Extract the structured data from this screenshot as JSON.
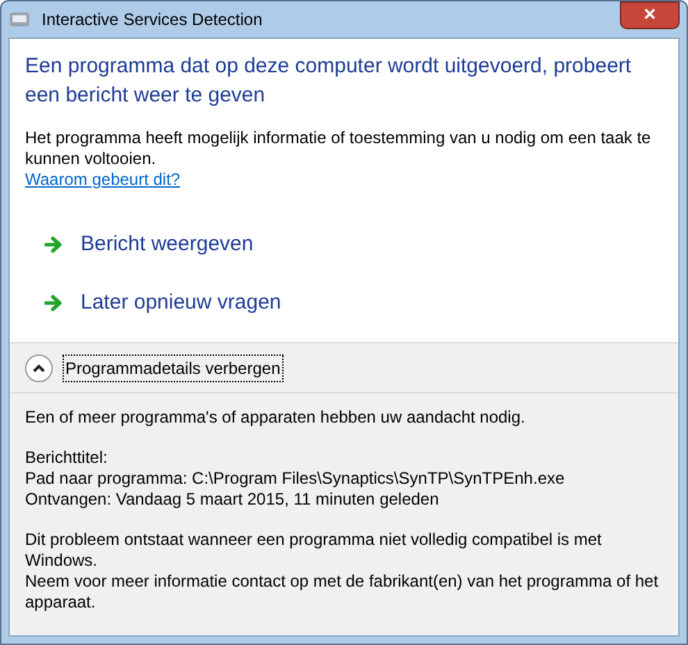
{
  "window": {
    "title": "Interactive Services Detection",
    "close": "×"
  },
  "heading": "Een programma dat op deze computer wordt uitgevoerd, probeert een bericht weer te geven",
  "description": "Het programma heeft mogelijk informatie of toestemming van u nodig om een taak te kunnen voltooien.",
  "help_link": "Waarom gebeurt dit?",
  "commands": [
    {
      "label": "Bericht weergeven"
    },
    {
      "label": "Later opnieuw vragen"
    }
  ],
  "details_toggle": {
    "label": "Programmadetails verbergen",
    "expanded": true
  },
  "details": [
    [
      "Een of meer programma's of apparaten hebben uw aandacht nodig."
    ],
    [
      "Berichttitel:",
      "Pad naar programma: C:\\Program Files\\Synaptics\\SynTP\\SynTPEnh.exe",
      "Ontvangen: Vandaag 5 maart 2015, 11 minuten geleden"
    ],
    [
      "Dit probleem ontstaat wanneer een programma niet volledig compatibel is met Windows.",
      "Neem voor meer informatie contact op met de fabrikant(en) van het programma of het apparaat."
    ]
  ]
}
